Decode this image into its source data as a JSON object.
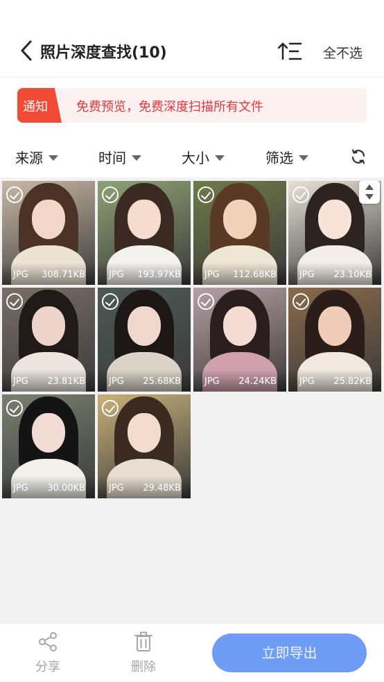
{
  "header": {
    "title": "照片深度查找(10)",
    "deselect_label": "全不选"
  },
  "notice": {
    "tag": "通知",
    "text": "免费预览，免费深度扫描所有文件"
  },
  "filters": [
    {
      "label": "来源"
    },
    {
      "label": "时间"
    },
    {
      "label": "大小"
    },
    {
      "label": "筛选"
    }
  ],
  "photos": [
    {
      "type": "JPG",
      "size": "308.71KB",
      "bg": "#c9b8a6",
      "hair": "#4a3326",
      "skin": "#f2d6c7",
      "cloth": "#ece3d5"
    },
    {
      "type": "JPG",
      "size": "193.97KB",
      "bg": "#8fa274",
      "hair": "#3b2a21",
      "skin": "#f4dccf",
      "cloth": "#f4f2ee"
    },
    {
      "type": "JPG",
      "size": "112.68KB",
      "bg": "#6f7a49",
      "hair": "#5a3a25",
      "skin": "#f1d3bc",
      "cloth": "#efe6d6"
    },
    {
      "type": "JPG",
      "size": "23.10KB",
      "bg": "#e8e1d6",
      "hair": "#2c2420",
      "skin": "#f7e3d8",
      "cloth": "#f3efe6"
    },
    {
      "type": "JPG",
      "size": "23.81KB",
      "bg": "#7a6f66",
      "hair": "#201a18",
      "skin": "#edd3c9",
      "cloth": "#ece6de"
    },
    {
      "type": "JPG",
      "size": "25.68KB",
      "bg": "#4d5a55",
      "hair": "#1d1816",
      "skin": "#efd7cd",
      "cloth": "#d9d3c8"
    },
    {
      "type": "JPG",
      "size": "24.24KB",
      "bg": "#b7a0a4",
      "hair": "#2a1f1e",
      "skin": "#f4dcd3",
      "cloth": "#cfa1ad"
    },
    {
      "type": "JPG",
      "size": "25.82KB",
      "bg": "#8a6a4a",
      "hair": "#2b1e18",
      "skin": "#f0cdb9",
      "cloth": "#efe9df"
    },
    {
      "type": "JPG",
      "size": "30.00KB",
      "bg": "#79806f",
      "hair": "#141414",
      "skin": "#f1ddd3",
      "cloth": "#f1f1ea"
    },
    {
      "type": "JPG",
      "size": "29.48KB",
      "bg": "#c8b27a",
      "hair": "#3a2a20",
      "skin": "#f4dccc",
      "cloth": "#e6ded0"
    }
  ],
  "actions": {
    "share_label": "分享",
    "delete_label": "删除",
    "export_label": "立即导出"
  },
  "colors": {
    "accent": "#6f9cf5",
    "notice_red": "#f24a35",
    "notice_text": "#e8383b"
  }
}
